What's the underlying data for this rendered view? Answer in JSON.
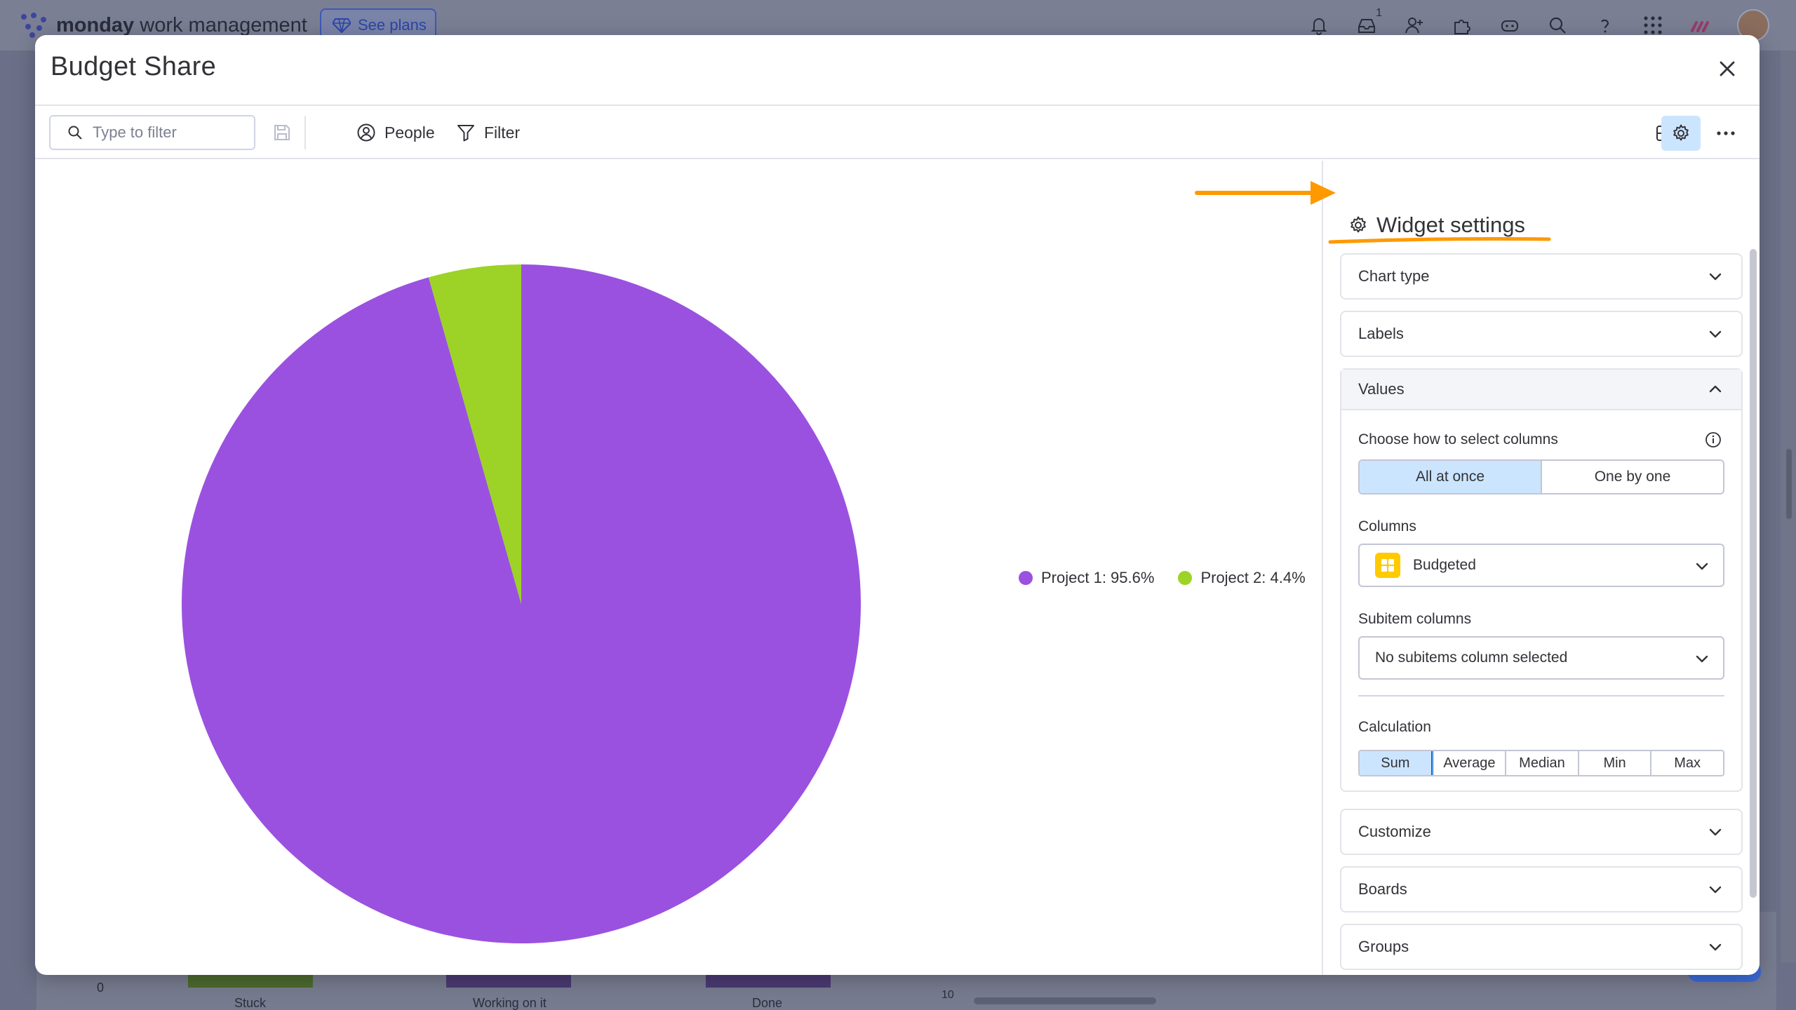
{
  "background": {
    "brand_bold": "monday",
    "brand_rest": "work management",
    "see_plans": "See plans",
    "notification_count": "1",
    "chart_zero": "0",
    "chart_ten": "10",
    "bar_labels": [
      "Stuck",
      "Working on it",
      "Done"
    ]
  },
  "modal": {
    "title": "Budget Share",
    "toolbar": {
      "search_placeholder": "Type to filter",
      "people_label": "People",
      "filter_label": "Filter"
    }
  },
  "chart_data": {
    "type": "pie",
    "title": "",
    "slices": [
      {
        "name": "Project 1",
        "value": 95.6,
        "color": "#9b51e0",
        "legend": "Project 1: 95.6%"
      },
      {
        "name": "Project 2",
        "value": 4.4,
        "color": "#9cd326",
        "legend": "Project 2: 4.4%"
      }
    ],
    "legend_position": "right"
  },
  "settings": {
    "title": "Widget settings",
    "sections": {
      "chart_type": "Chart type",
      "labels": "Labels",
      "values": "Values",
      "customize": "Customize",
      "boards": "Boards",
      "groups": "Groups"
    },
    "values": {
      "choose_label": "Choose how to select columns",
      "mode_options": [
        "All at once",
        "One by one"
      ],
      "mode_selected": "All at once",
      "columns_label": "Columns",
      "columns_value": "Budgeted",
      "subitem_label": "Subitem columns",
      "subitem_value": "No subitems column selected",
      "calc_label": "Calculation",
      "calc_options": [
        "Sum",
        "Average",
        "Median",
        "Min",
        "Max"
      ],
      "calc_selected": "Sum"
    }
  },
  "colors": {
    "accent": "#0073ea",
    "selected_bg": "#cce5ff",
    "annotation": "#ff9900"
  }
}
